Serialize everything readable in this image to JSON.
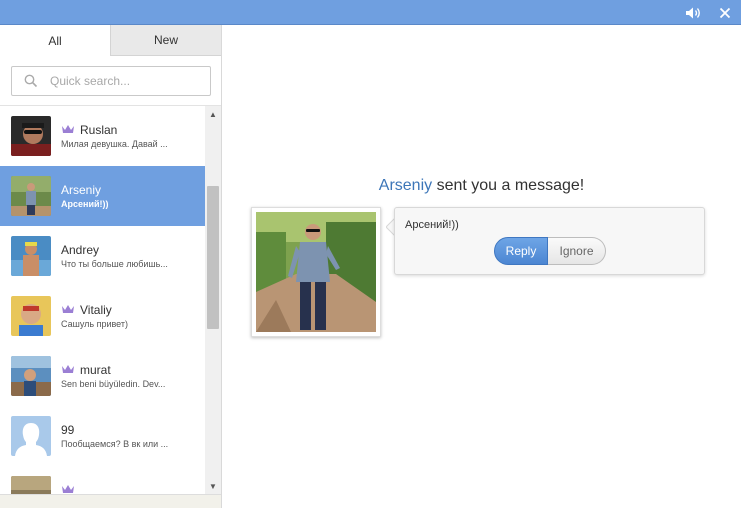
{
  "titlebar": {
    "sound_icon": "speaker-icon",
    "close_icon": "close-icon"
  },
  "sidebar": {
    "tabs": [
      {
        "label": "All",
        "active": true
      },
      {
        "label": "New",
        "active": false
      }
    ],
    "search": {
      "placeholder": "Quick search...",
      "value": ""
    },
    "contacts": [
      {
        "name": "Ruslan",
        "preview": "Милая девушка. Давай ...",
        "crown": true,
        "selected": false
      },
      {
        "name": "Arseniy",
        "preview": "Арсений!))",
        "crown": false,
        "selected": true
      },
      {
        "name": "Andrey",
        "preview": "Что ты больше любишь...",
        "crown": false,
        "selected": false
      },
      {
        "name": "Vitaliy",
        "preview": "Сашуль привет)",
        "crown": true,
        "selected": false
      },
      {
        "name": "murat",
        "preview": "Sen beni büyüledin. Dev...",
        "crown": true,
        "selected": false
      },
      {
        "name": "99",
        "preview": "Пообщаемся? В вк или ...",
        "crown": false,
        "selected": false
      },
      {
        "name": "",
        "preview": "",
        "crown": true,
        "selected": false
      }
    ]
  },
  "main": {
    "sender": "Arseniy",
    "headline_rest": " sent you a message!",
    "message": "Арсений!))",
    "reply_label": "Reply",
    "ignore_label": "Ignore"
  },
  "colors": {
    "titlebar": "#6f9fe0",
    "selected_row": "#6f9fe0",
    "sender_link": "#3d76b8",
    "crown": "#9b7fd4",
    "reply_button": "#4c86d2"
  }
}
